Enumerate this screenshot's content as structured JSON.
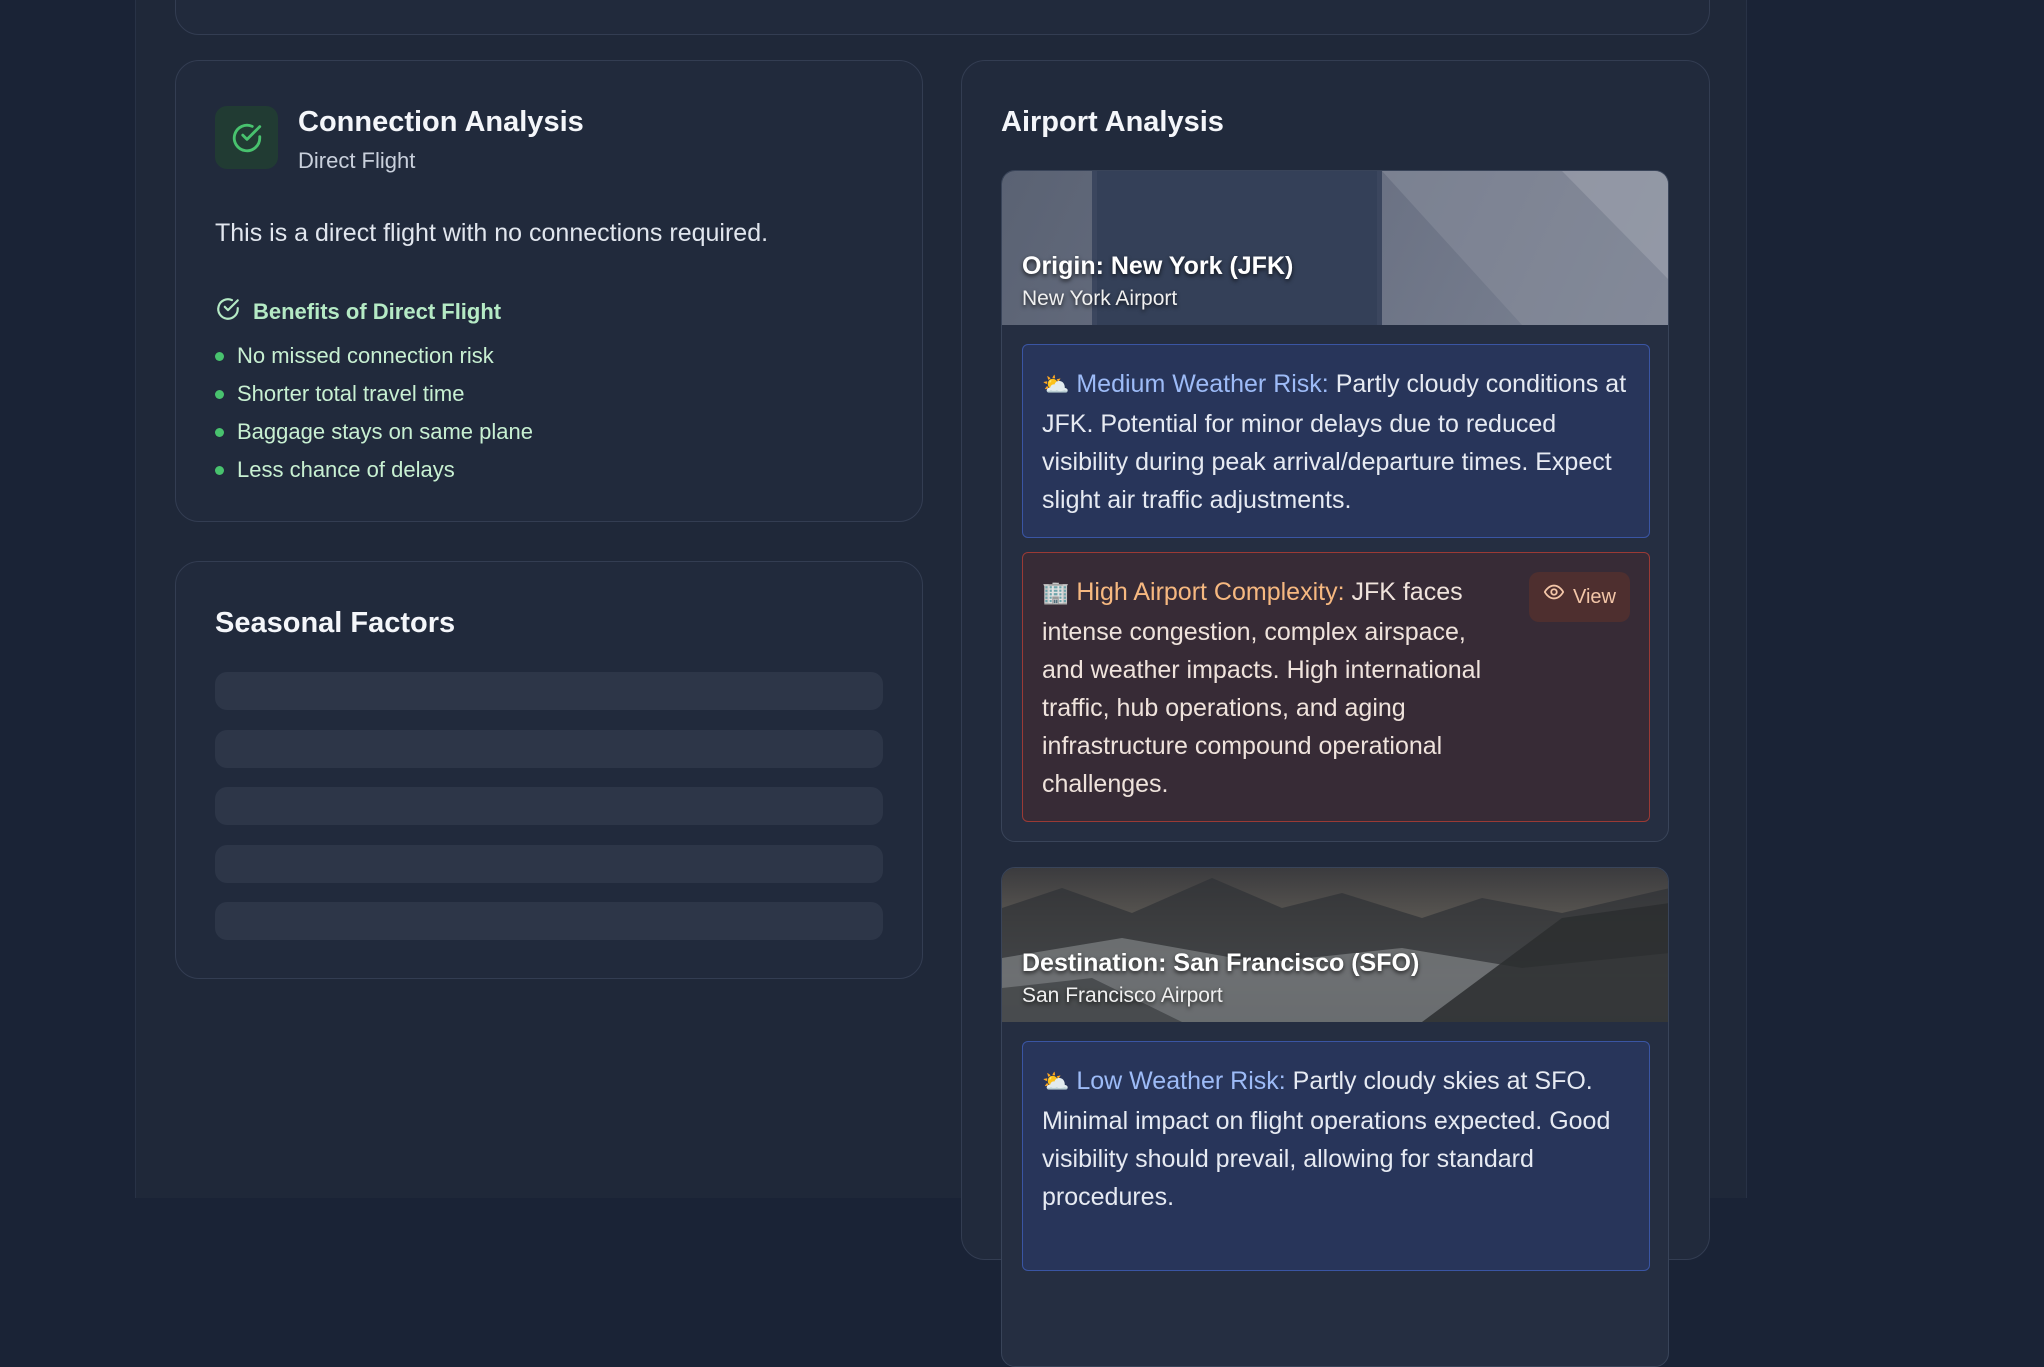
{
  "connection": {
    "title": "Connection Analysis",
    "subtitle": "Direct Flight",
    "description": "This is a direct flight with no connections required.",
    "benefits_title": "Benefits of Direct Flight",
    "benefits": [
      "No missed connection risk",
      "Shorter total travel time",
      "Baggage stays on same plane",
      "Less chance of delays"
    ],
    "icon": "check-circle-icon",
    "accent_color": "#48c26e"
  },
  "seasonal": {
    "title": "Seasonal Factors",
    "loading": true
  },
  "airport": {
    "title": "Airport Analysis",
    "origin": {
      "title": "Origin: New York (JFK)",
      "subtitle": "New York Airport",
      "weather": {
        "icon": "⛅",
        "label": "Medium Weather Risk:",
        "text": " Partly cloudy conditions at JFK. Potential for minor delays due to reduced visibility during peak arrival/departure times. Expect slight air traffic adjustments."
      },
      "complexity": {
        "icon": "🏢",
        "label": "High Airport Complexity:",
        "text": " JFK faces intense congestion, complex airspace, and weather impacts. High international traffic, hub operations, and aging infrastructure compound operational challenges.",
        "view_label": "View"
      }
    },
    "destination": {
      "title": "Destination: San Francisco (SFO)",
      "subtitle": "San Francisco Airport",
      "weather": {
        "icon": "⛅",
        "label": "Low Weather Risk:",
        "text": " Partly cloudy skies at SFO. Minimal impact on flight operations expected. Good visibility should prevail, allowing for standard procedures."
      }
    }
  }
}
